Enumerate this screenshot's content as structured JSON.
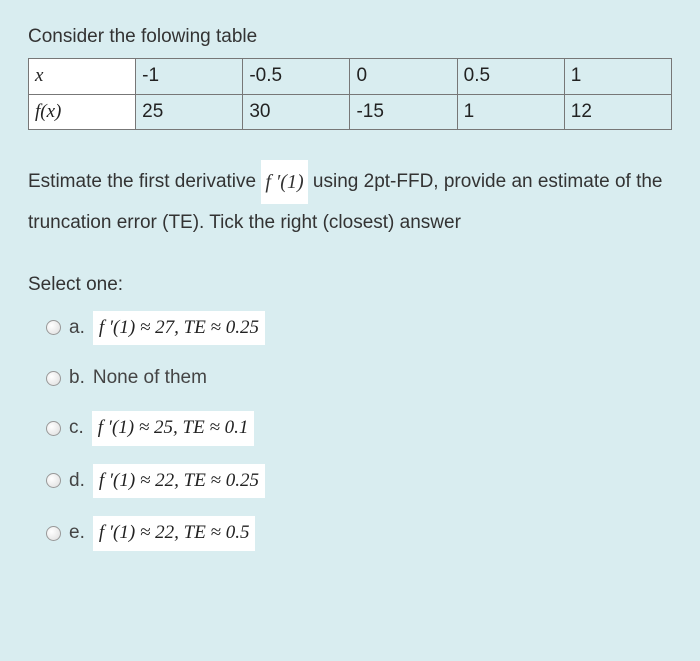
{
  "prompt": "Consider the folowing table",
  "table": {
    "row1_header": "x",
    "row1": [
      "-1",
      "-0.5",
      "0",
      "0.5",
      "1"
    ],
    "row2_header": "f(x)",
    "row2": [
      "25",
      "30",
      "-15",
      "1",
      "12"
    ]
  },
  "question": {
    "part1": "Estimate the first derivative ",
    "math": "f ′(1)",
    "part2": " using 2pt-FFD, provide an estimate of the truncation error (TE).  Tick the right (closest) answer"
  },
  "select_one": "Select one:",
  "options": {
    "a": {
      "label": "a.",
      "math": "f ′(1) ≈ 27,  TE ≈ 0.25"
    },
    "b": {
      "label": "b.",
      "text": "None of them"
    },
    "c": {
      "label": "c.",
      "math": "f ′(1) ≈ 25,  TE ≈ 0.1"
    },
    "d": {
      "label": "d.",
      "math": "f ′(1) ≈ 22,  TE ≈ 0.25"
    },
    "e": {
      "label": "e.",
      "math": "f ′(1) ≈ 22,  TE ≈ 0.5"
    }
  }
}
